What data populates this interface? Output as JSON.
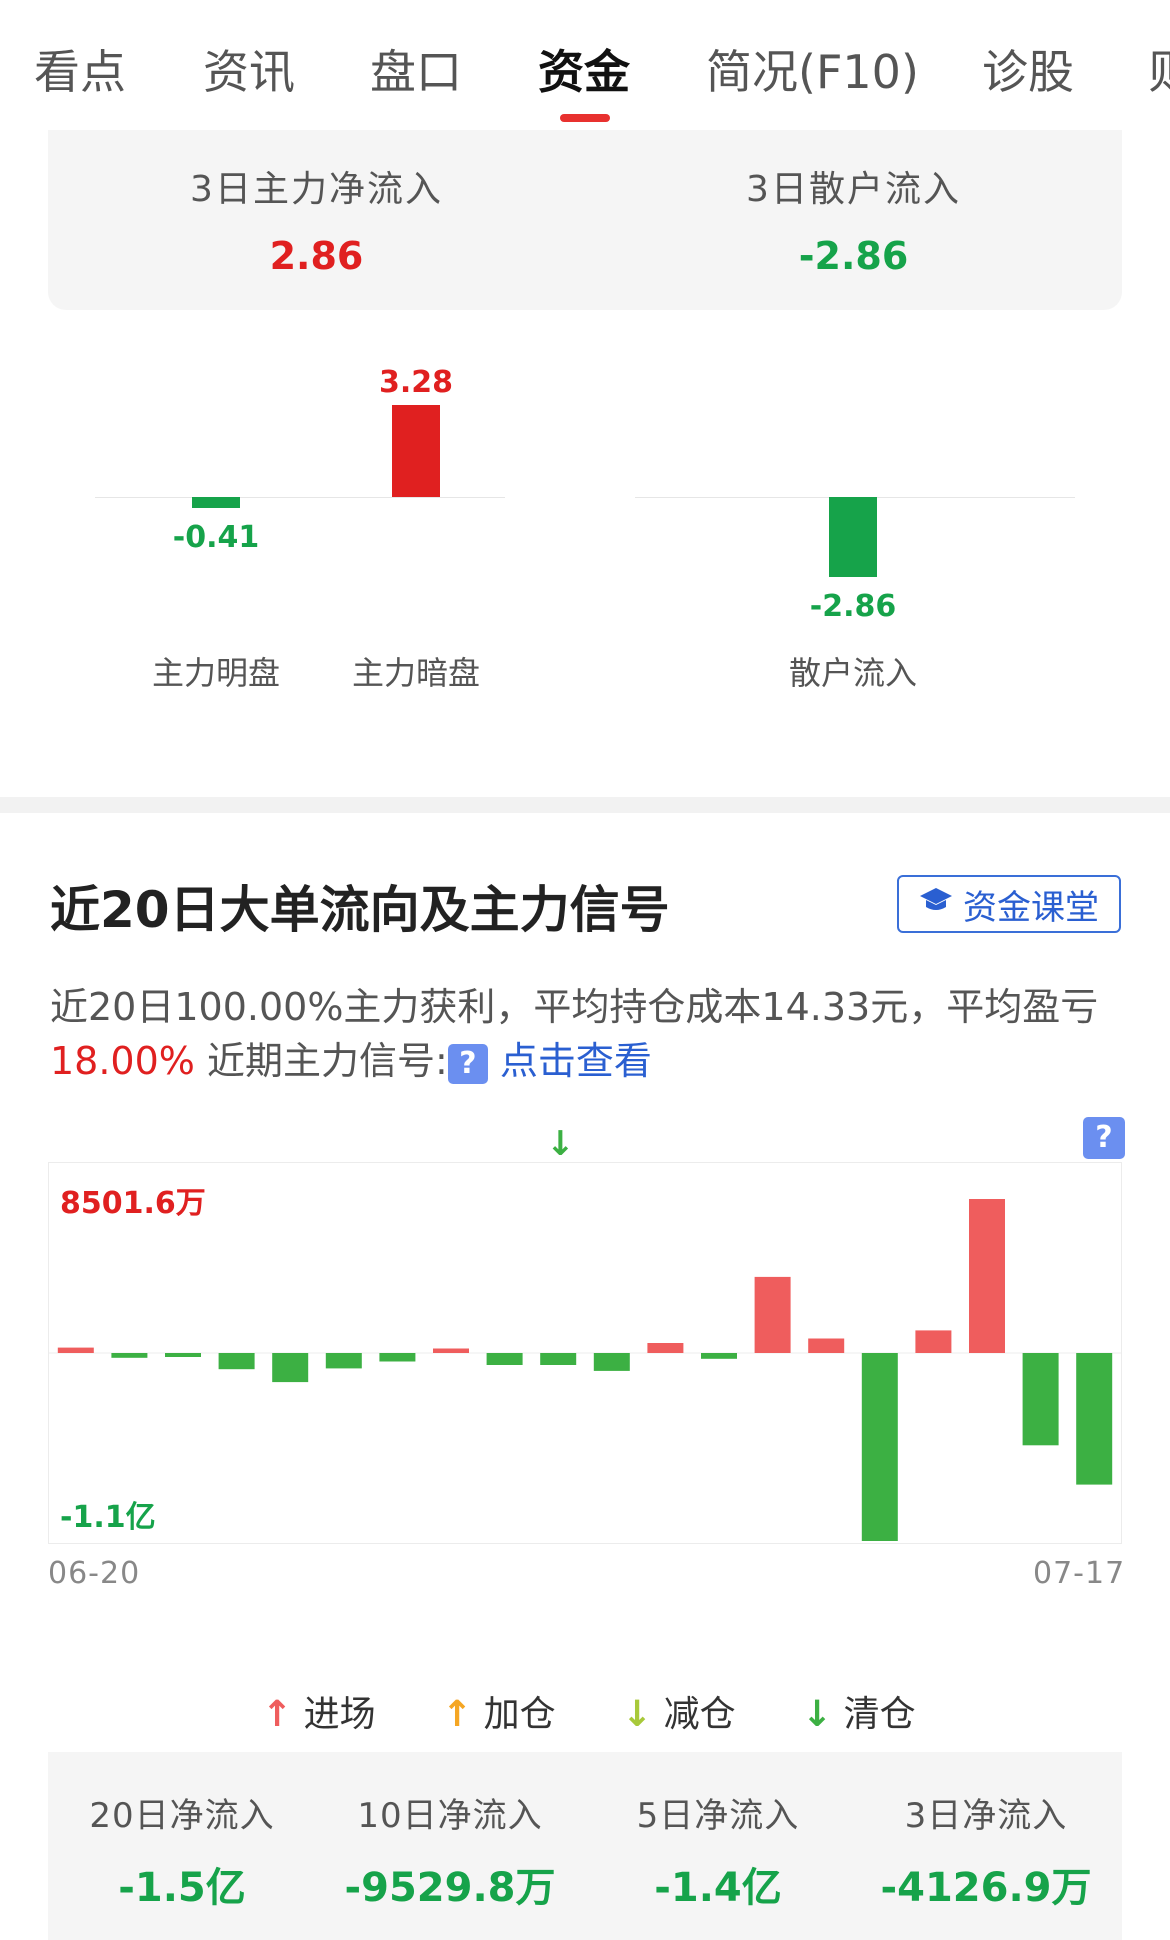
{
  "tabs": [
    "看点",
    "资讯",
    "盘口",
    "资金",
    "简况(F10)",
    "诊股",
    "则"
  ],
  "summary": {
    "left_label": "3日主力净流入",
    "left_value": "2.86",
    "right_label": "3日散户流入",
    "right_value": "-2.86"
  },
  "mini_chart": {
    "bars": [
      {
        "label": "主力明盘",
        "value": -0.41,
        "value_text": "-0.41"
      },
      {
        "label": "主力暗盘",
        "value": 3.28,
        "value_text": "3.28"
      },
      {
        "label": "散户流入",
        "value": -2.86,
        "value_text": "-2.86"
      }
    ]
  },
  "section": {
    "title": "近20日大单流向及主力信号",
    "course_button": "资金课堂",
    "desc_part1": "近20日100.00%主力获利，平均持仓成本14.33元，平均盈亏",
    "desc_pct": "18.00%",
    "desc_part2": "近期主力信号:",
    "desc_help_icon": "?",
    "desc_link": "点击查看"
  },
  "chart_data": {
    "type": "bar",
    "x_start": "06-20",
    "x_end": "07-17",
    "max_label": "8501.6万",
    "min_label": "-1.1亿",
    "unit": "万",
    "ylim": [
      -11000,
      8501.6
    ],
    "values": [
      300,
      -280,
      -80,
      -950,
      -1700,
      -900,
      -500,
      250,
      -700,
      -700,
      -1050,
      550,
      -340,
      4200,
      800,
      -11000,
      1250,
      8501.6,
      -5400,
      -7700
    ],
    "colors": {
      "positive": "#ef5d5d",
      "negative": "#3cb043"
    }
  },
  "legend": [
    {
      "label": "进场",
      "arrow": "↑",
      "color": "#ef5d5d"
    },
    {
      "label": "加仓",
      "arrow": "↑",
      "color": "#f5a623"
    },
    {
      "label": "减仓",
      "arrow": "↓",
      "color": "#a8c93a"
    },
    {
      "label": "清仓",
      "arrow": "↓",
      "color": "#3cb043"
    }
  ],
  "stats": [
    {
      "label": "20日净流入",
      "value": "-1.5亿"
    },
    {
      "label": "10日净流入",
      "value": "-9529.8万"
    },
    {
      "label": "5日净流入",
      "value": "-1.4亿"
    },
    {
      "label": "3日净流入",
      "value": "-4126.9万"
    }
  ]
}
